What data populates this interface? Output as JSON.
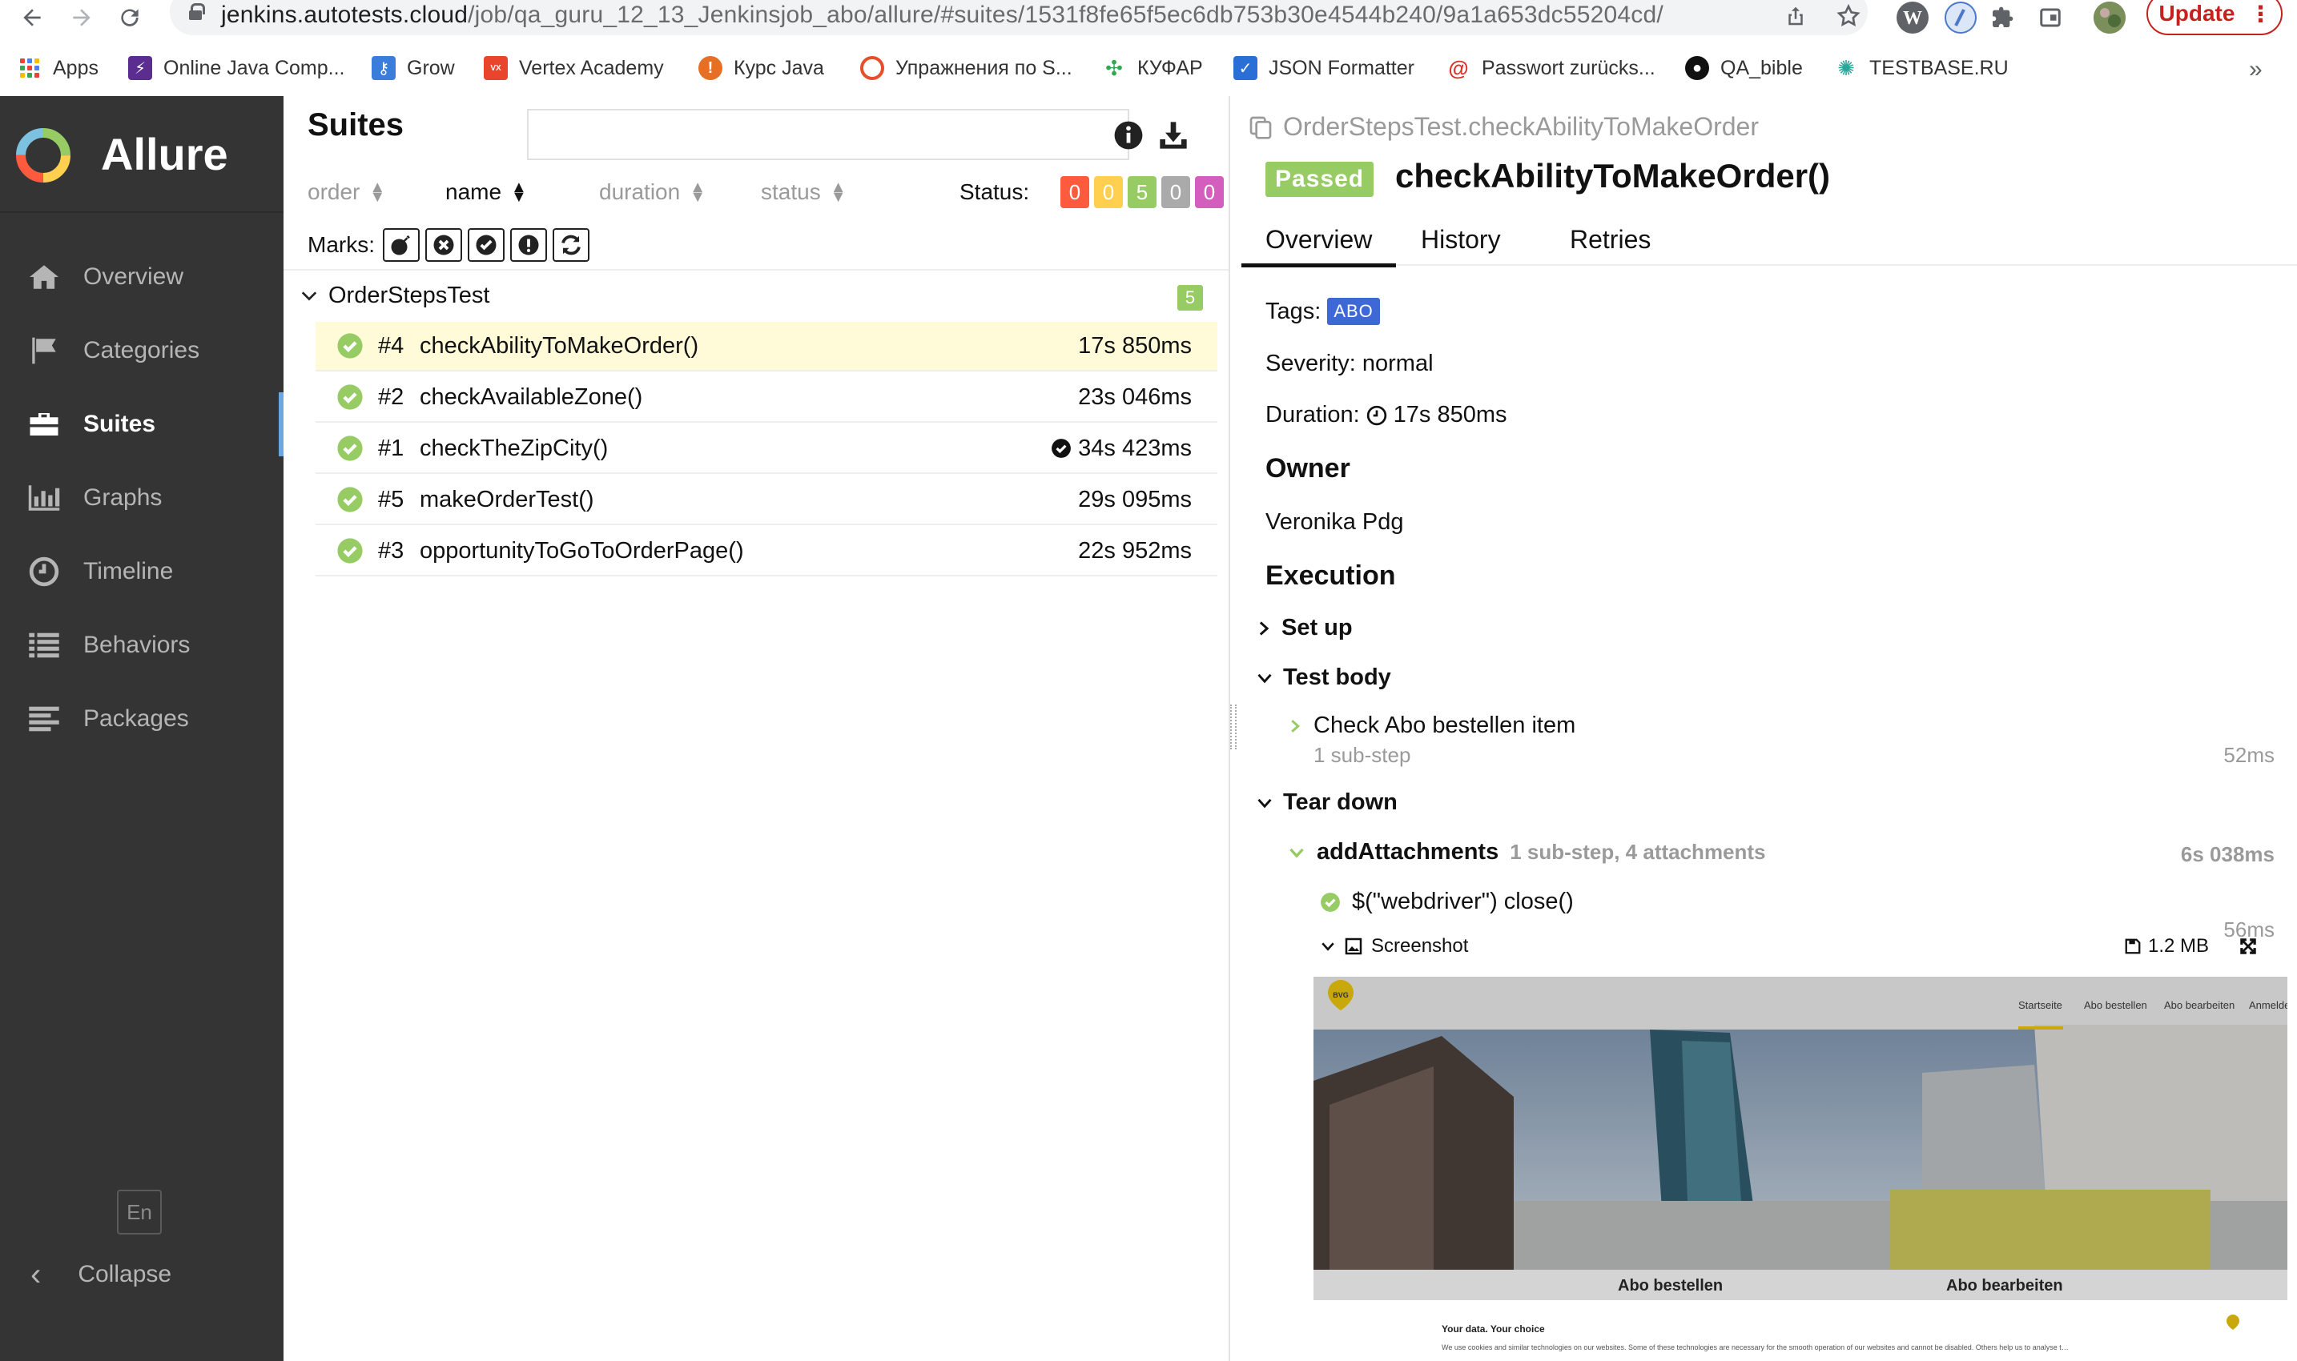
{
  "browser": {
    "url_host": "jenkins.autotests.cloud",
    "url_path": "/job/qa_guru_12_13_Jenkinsjob_abo/allure/#suites/1531f8fe65f5ec6db753b30e4544b240/9a1a653dc55204cd/",
    "update_label": "Update",
    "bookmarks": [
      {
        "label": "Apps",
        "icon": "apps-icon"
      },
      {
        "label": "Online Java Comp...",
        "icon": "bolt-icon",
        "color": "#5b2d90"
      },
      {
        "label": "Grow",
        "icon": "key-icon",
        "color": "#3b7ddd"
      },
      {
        "label": "Vertex Academy",
        "icon": "vertex-icon",
        "color": "#e8452c"
      },
      {
        "label": "Курс Java",
        "icon": "java-icon",
        "color": "#e76f24"
      },
      {
        "label": "Упражнения по S...",
        "icon": "target-icon",
        "color": "#e3502b"
      },
      {
        "label": "КУФАР",
        "icon": "kufar-icon",
        "color": "#2fa84f"
      },
      {
        "label": "JSON Formatter",
        "icon": "check-square-icon",
        "color": "#2a6fd6"
      },
      {
        "label": "Passwort zurücks...",
        "icon": "mail-icon",
        "color": "#d9342b"
      },
      {
        "label": "QA_bible",
        "icon": "github-icon",
        "color": "#111111"
      },
      {
        "label": "TESTBASE.RU",
        "icon": "virus-icon",
        "color": "#2aa59a"
      }
    ]
  },
  "sidebar": {
    "brand": "Allure",
    "items": [
      {
        "label": "Overview",
        "icon": "home-icon"
      },
      {
        "label": "Categories",
        "icon": "flag-icon"
      },
      {
        "label": "Suites",
        "icon": "briefcase-icon",
        "active": true
      },
      {
        "label": "Graphs",
        "icon": "bar-chart-icon"
      },
      {
        "label": "Timeline",
        "icon": "clock-icon"
      },
      {
        "label": "Behaviors",
        "icon": "list-icon"
      },
      {
        "label": "Packages",
        "icon": "align-left-icon"
      }
    ],
    "lang": "En",
    "collapse_label": "Collapse"
  },
  "suites": {
    "title": "Suites",
    "search_value": "",
    "sort": [
      "order",
      "name",
      "duration",
      "status"
    ],
    "status_label": "Status:",
    "status_counts": [
      {
        "value": "0",
        "color": "#fd5a3e"
      },
      {
        "value": "0",
        "color": "#ffd050"
      },
      {
        "value": "5",
        "color": "#97cc64"
      },
      {
        "value": "0",
        "color": "#aaaaaa"
      },
      {
        "value": "0",
        "color": "#d35ebe"
      }
    ],
    "marks_label": "Marks:",
    "group": {
      "name": "OrderStepsTest",
      "count": "5"
    },
    "tests": [
      {
        "num": "#4",
        "name": "checkAbilityToMakeOrder()",
        "duration": "17s 850ms",
        "selected": true
      },
      {
        "num": "#2",
        "name": "checkAvailableZone()",
        "duration": "23s 046ms"
      },
      {
        "num": "#1",
        "name": "checkTheZipCity()",
        "duration": "34s 423ms",
        "flag": true
      },
      {
        "num": "#5",
        "name": "makeOrderTest()",
        "duration": "29s 095ms"
      },
      {
        "num": "#3",
        "name": "opportunityToGoToOrderPage()",
        "duration": "22s 952ms"
      }
    ]
  },
  "detail": {
    "breadcrumb": "OrderStepsTest.checkAbilityToMakeOrder",
    "status": "Passed",
    "title": "checkAbilityToMakeOrder()",
    "tabs": [
      "Overview",
      "History",
      "Retries"
    ],
    "tags_label": "Tags:",
    "tag": "ABO",
    "severity": "Severity: normal",
    "duration_label": "Duration:",
    "duration": "17s 850ms",
    "owner_heading": "Owner",
    "owner": "Veronika Pdg",
    "execution_heading": "Execution",
    "setup": "Set up",
    "test_body": "Test body",
    "step_name": "Check Abo bestellen item",
    "step_meta": "1 sub-step",
    "step_time": "52ms",
    "tear_down": "Tear down",
    "teardown_step": "addAttachments",
    "teardown_meta": "1 sub-step, 4 attachments",
    "teardown_time": "6s 038ms",
    "sub_step": "$(\"webdriver\") close()",
    "sub_time": "56ms",
    "attachment_name": "Screenshot",
    "attachment_size": "1.2 MB",
    "screenshot": {
      "nav": [
        "Startseite",
        "Abo bestellen",
        "Abo bearbeiten",
        "Anmelden"
      ],
      "logo": "BVG",
      "tile_left": "Abo bestellen",
      "tile_right": "Abo bearbeiten",
      "cookie_title": "Your data. Your choice",
      "cookie_text": "We use cookies and similar technologies on our websites. Some of these technologies are necessary for the smooth operation of our websites and cannot be disabled. Others help us to analyse the usage of our offering, to measure the success of our advertising and thus to make our offering even more tailored to you."
    }
  }
}
